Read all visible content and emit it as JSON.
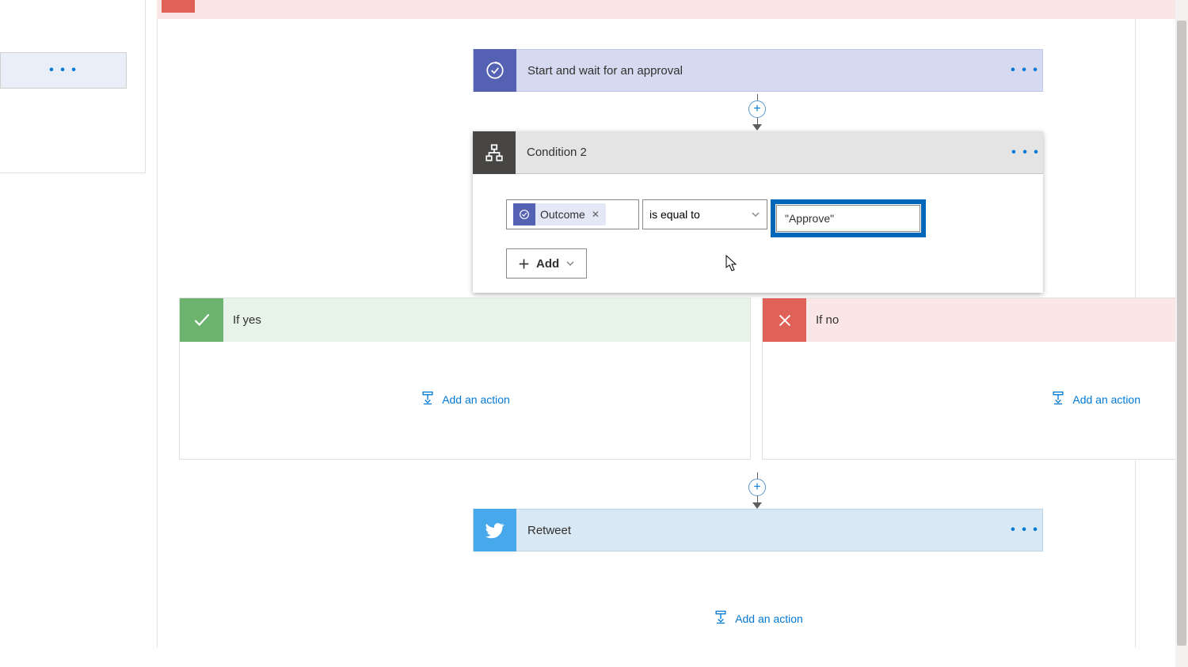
{
  "top": {
    "if_no_fragment": "If no"
  },
  "approval": {
    "title": "Start and wait for an approval"
  },
  "condition": {
    "title": "Condition 2",
    "token": "Outcome",
    "operator": "is equal to",
    "value": "\"Approve\"",
    "add": "Add"
  },
  "branches": {
    "yes": {
      "title": "If yes",
      "add": "Add an action"
    },
    "no": {
      "title": "If no",
      "add": "Add an action"
    }
  },
  "retweet": {
    "title": "Retweet"
  },
  "bottom": {
    "add": "Add an action"
  }
}
